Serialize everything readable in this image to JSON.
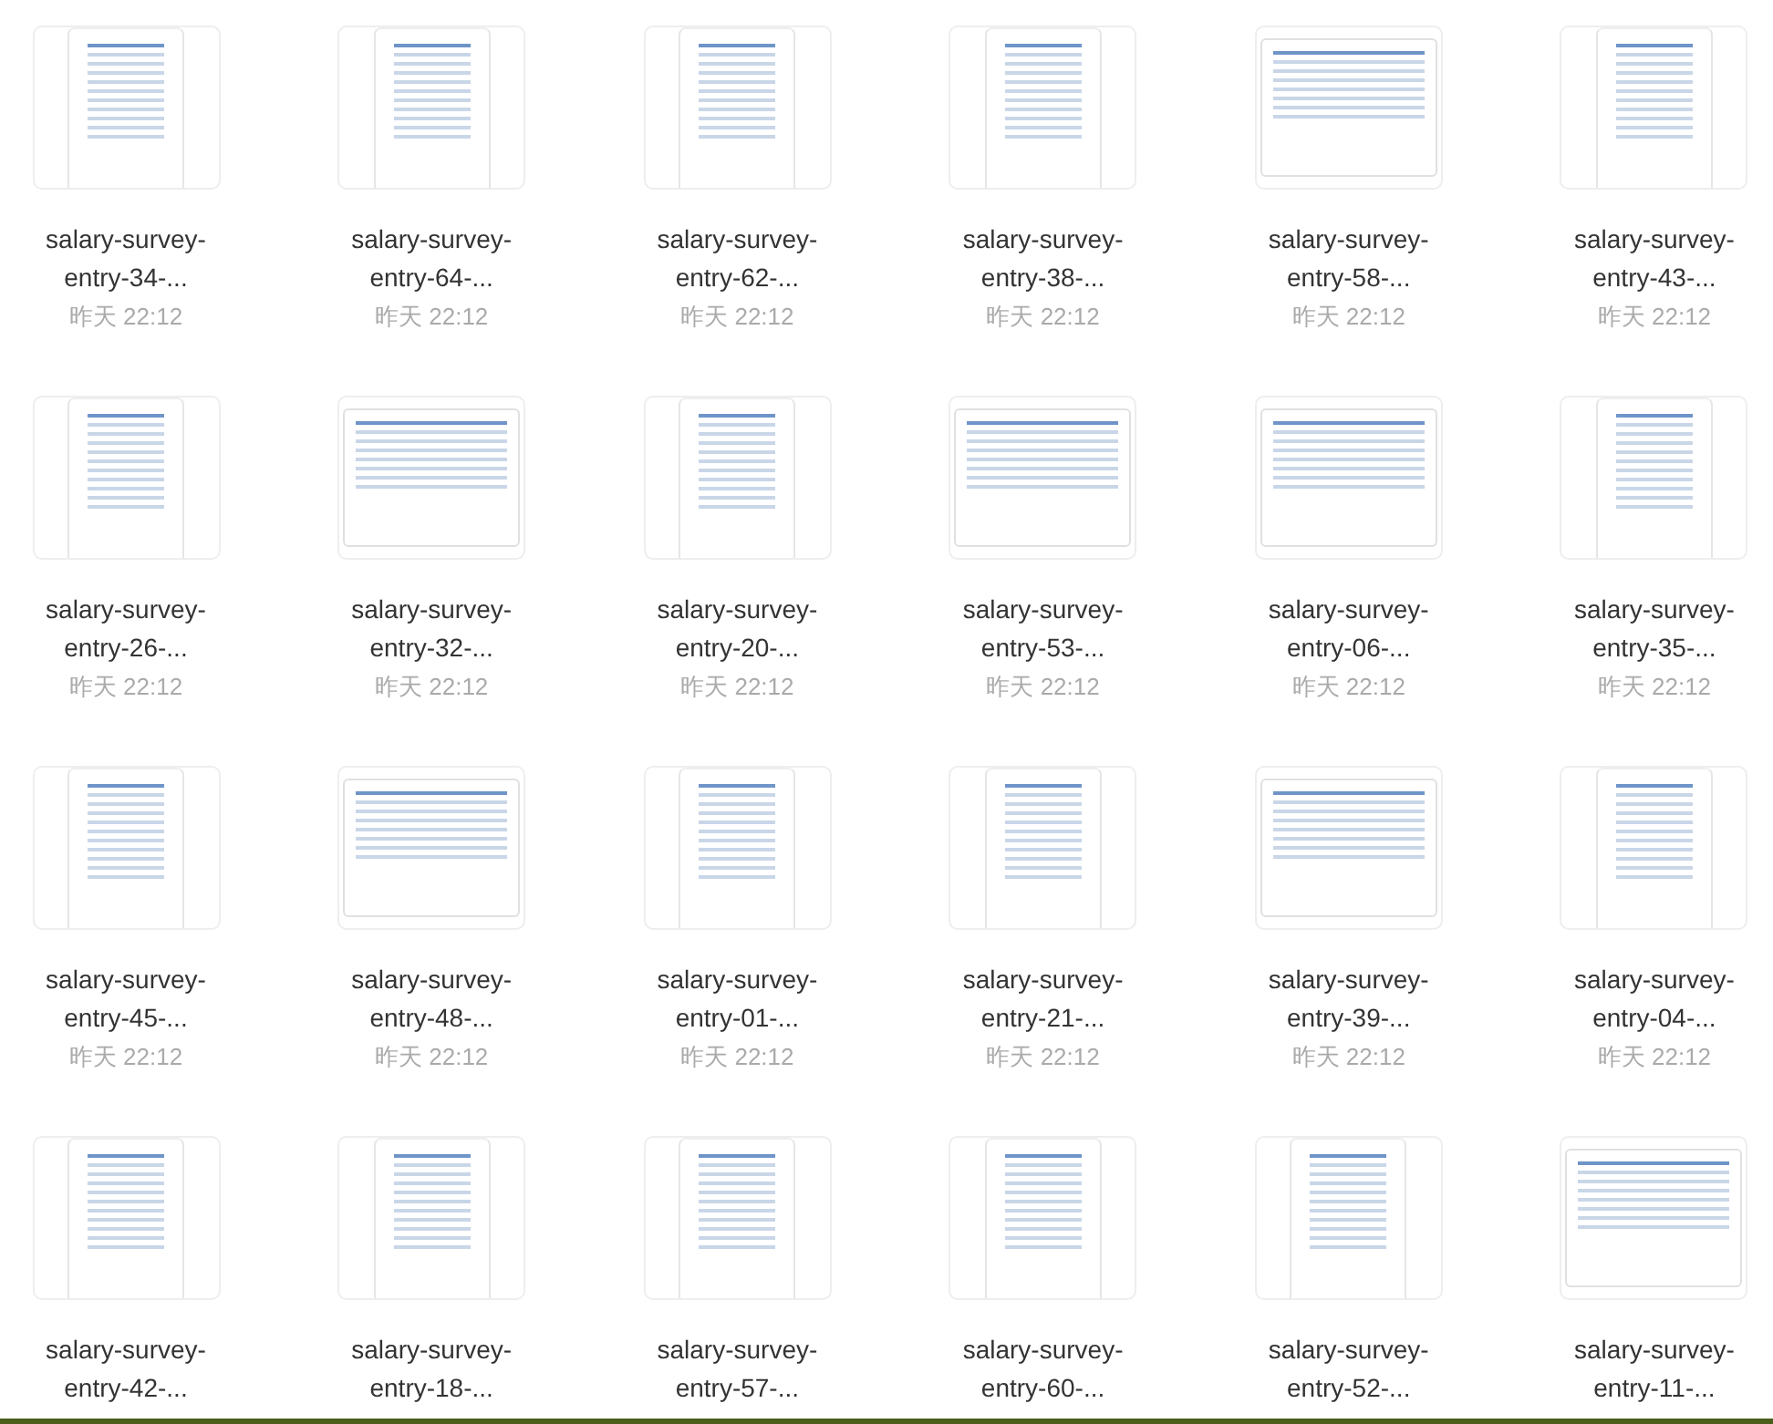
{
  "files": [
    {
      "name": "salary-survey-entry-34-...",
      "date": "昨天 22:12",
      "kind": "portrait"
    },
    {
      "name": "salary-survey-entry-64-...",
      "date": "昨天 22:12",
      "kind": "portrait"
    },
    {
      "name": "salary-survey-entry-62-...",
      "date": "昨天 22:12",
      "kind": "portrait"
    },
    {
      "name": "salary-survey-entry-38-...",
      "date": "昨天 22:12",
      "kind": "portrait"
    },
    {
      "name": "salary-survey-entry-58-...",
      "date": "昨天 22:12",
      "kind": "landscape"
    },
    {
      "name": "salary-survey-entry-43-...",
      "date": "昨天 22:12",
      "kind": "portrait"
    },
    {
      "name": "salary-survey-entry-26-...",
      "date": "昨天 22:12",
      "kind": "portrait"
    },
    {
      "name": "salary-survey-entry-32-...",
      "date": "昨天 22:12",
      "kind": "landscape"
    },
    {
      "name": "salary-survey-entry-20-...",
      "date": "昨天 22:12",
      "kind": "portrait"
    },
    {
      "name": "salary-survey-entry-53-...",
      "date": "昨天 22:12",
      "kind": "landscape"
    },
    {
      "name": "salary-survey-entry-06-...",
      "date": "昨天 22:12",
      "kind": "landscape"
    },
    {
      "name": "salary-survey-entry-35-...",
      "date": "昨天 22:12",
      "kind": "portrait"
    },
    {
      "name": "salary-survey-entry-45-...",
      "date": "昨天 22:12",
      "kind": "portrait"
    },
    {
      "name": "salary-survey-entry-48-...",
      "date": "昨天 22:12",
      "kind": "landscape"
    },
    {
      "name": "salary-survey-entry-01-...",
      "date": "昨天 22:12",
      "kind": "portrait"
    },
    {
      "name": "salary-survey-entry-21-...",
      "date": "昨天 22:12",
      "kind": "portrait"
    },
    {
      "name": "salary-survey-entry-39-...",
      "date": "昨天 22:12",
      "kind": "landscape"
    },
    {
      "name": "salary-survey-entry-04-...",
      "date": "昨天 22:12",
      "kind": "portrait"
    },
    {
      "name": "salary-survey-entry-42-...",
      "kind": "portrait"
    },
    {
      "name": "salary-survey-entry-18-...",
      "kind": "portrait"
    },
    {
      "name": "salary-survey-entry-57-...",
      "kind": "portrait"
    },
    {
      "name": "salary-survey-entry-60-...",
      "kind": "portrait"
    },
    {
      "name": "salary-survey-entry-52-...",
      "kind": "portrait"
    },
    {
      "name": "salary-survey-entry-11-...",
      "kind": "landscape"
    }
  ]
}
